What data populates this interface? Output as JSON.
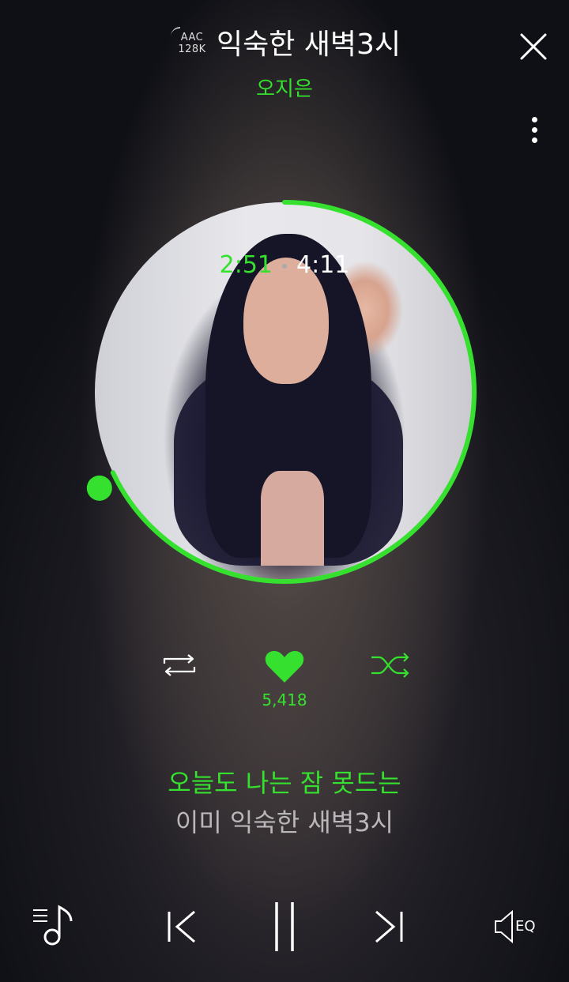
{
  "header": {
    "quality_codec": "AAC",
    "quality_bitrate": "128K",
    "title": "익숙한 새벽3시",
    "artist": "오지은"
  },
  "icons": {
    "close": "close-icon",
    "more": "more-vertical-icon",
    "repeat": "repeat-icon",
    "like": "heart-icon",
    "shuffle": "shuffle-icon",
    "playlist": "playlist-icon",
    "prev": "skip-previous-icon",
    "pause": "pause-icon",
    "next": "skip-next-icon",
    "eq": "equalizer-speaker-icon"
  },
  "player": {
    "current_time": "2:51",
    "total_time": "4:11",
    "progress_fraction": 0.68,
    "likes": "5,418"
  },
  "lyrics": {
    "current": "오늘도 나는 잠 못드는",
    "next": "이미 익숙한 새벽3시"
  },
  "bottom": {
    "eq_label": "EQ"
  },
  "colors": {
    "accent": "#35e02f",
    "lyric_next": "#b9b7ba"
  }
}
